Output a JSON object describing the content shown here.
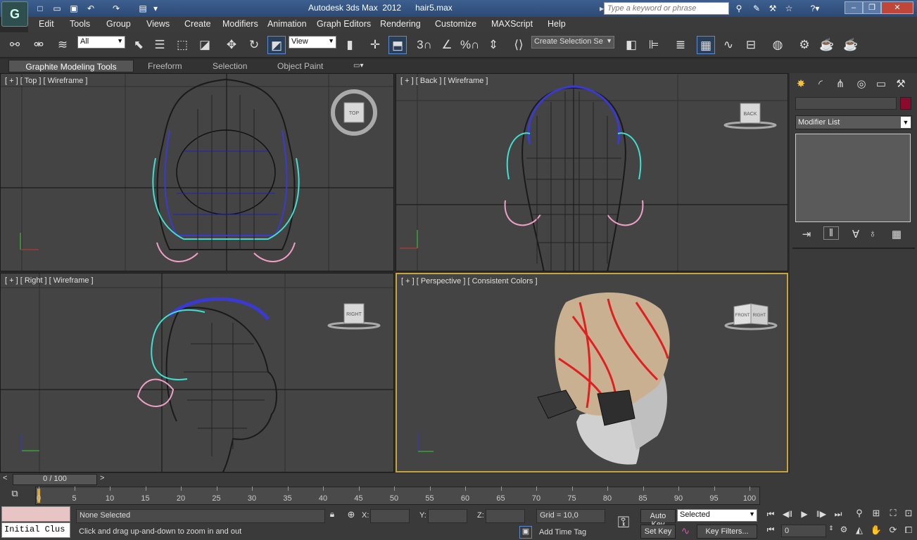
{
  "title_bar": {
    "app_title": "Autodesk 3ds Max  2012",
    "file_name": "hair5.max",
    "search_placeholder": "Type a keyword or phrase"
  },
  "menu": [
    "Edit",
    "Tools",
    "Group",
    "Views",
    "Create",
    "Modifiers",
    "Animation",
    "Graph Editors",
    "Rendering",
    "Customize",
    "MAXScript",
    "Help"
  ],
  "toolbar": {
    "selection_filter": "All",
    "reference_coord": "View",
    "named_selection": "Create Selection Se",
    "snap_3": "3",
    "percent_snap": "%"
  },
  "ribbon": {
    "tabs": [
      "Graphite Modeling Tools",
      "Freeform",
      "Selection",
      "Object Paint"
    ]
  },
  "viewports": {
    "top": {
      "label": "[ + ] [ Top ] [ Wireframe ]",
      "cube": "TOP"
    },
    "back": {
      "label": "[ + ] [ Back ] [ Wireframe ]",
      "cube": "BACK"
    },
    "right": {
      "label": "[ + ] [ Right ] [ Wireframe ]",
      "cube": "RIGHT"
    },
    "perspective": {
      "label": "[ + ] [ Perspective ] [ Consistent Colors ]",
      "cube_front": "FRONT",
      "cube_right": "RIGHT"
    }
  },
  "command_panel": {
    "modifier_list": "Modifier List",
    "object_color": "#8b0a2e"
  },
  "timeline": {
    "slider": "0 / 100",
    "ticks": [
      "0",
      "5",
      "10",
      "15",
      "20",
      "25",
      "30",
      "35",
      "40",
      "45",
      "50",
      "55",
      "60",
      "65",
      "70",
      "75",
      "80",
      "85",
      "90",
      "95",
      "100"
    ]
  },
  "status": {
    "maxscript_listener": "Initial Clus",
    "selection": "None Selected",
    "prompt": "Click and drag up-and-down to zoom in and out",
    "x_label": "X:",
    "y_label": "Y:",
    "z_label": "Z:",
    "grid": "Grid = 10,0",
    "add_time_tag": "Add Time Tag",
    "auto_key": "Auto Key",
    "set_key": "Set Key",
    "key_mode": "Selected",
    "key_filters": "Key Filters...",
    "frame": "0"
  },
  "colors": {
    "viewport_bg": "#444444",
    "active_border": "#c8a43c",
    "ui_bg": "#3a3a3a"
  }
}
